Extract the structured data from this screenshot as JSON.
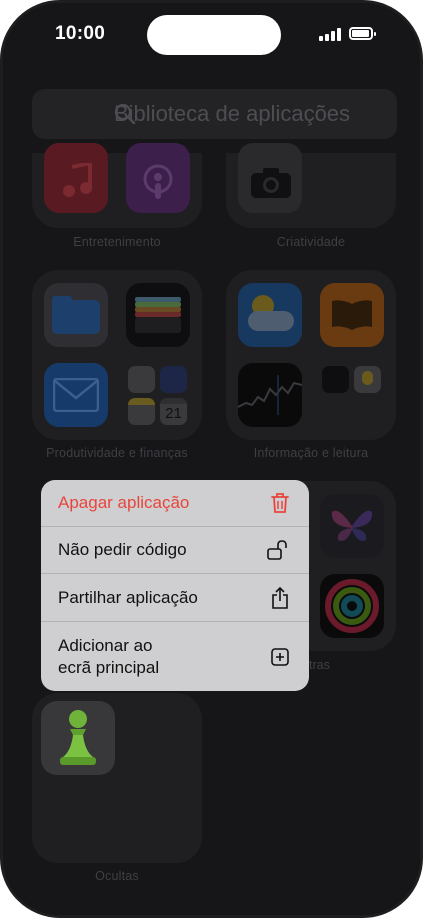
{
  "status": {
    "time": "10:00"
  },
  "search": {
    "placeholder": "Biblioteca de aplicações"
  },
  "folders": {
    "entertainment": "Entretenimento",
    "creativity": "Criatividade",
    "productivity": "Produtividade e finanças",
    "info": "Informação e leitura",
    "other_partial": "tras",
    "hidden": "Ocultas"
  },
  "calendar": {
    "day": "21"
  },
  "context_menu": {
    "items": [
      {
        "label": "Apagar aplicação",
        "icon": "trash-icon",
        "color": "#e8453c"
      },
      {
        "label": "Não pedir código",
        "icon": "unlock-icon"
      },
      {
        "label": "Partilhar aplicação",
        "icon": "share-icon"
      },
      {
        "label_line1": "Adicionar ao",
        "label_line2": "ecrã principal",
        "icon": "add-square-icon"
      }
    ]
  },
  "colors": {
    "background": "#161618",
    "menu": "#cfcfd1",
    "danger": "#e8453c"
  }
}
